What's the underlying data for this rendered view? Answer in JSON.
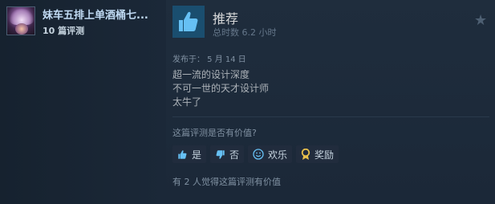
{
  "author": {
    "name": "妹车五排上单酒桶七...",
    "review_count": "10 篇评测"
  },
  "review": {
    "verdict": "推荐",
    "hours": "总时数 6.2 小时",
    "posted": "发布于：  5 月 14 日",
    "lines": [
      "超一流的设计深度",
      "不可一世的天才设计师",
      "太牛了"
    ]
  },
  "helpful": {
    "question": "这篇评测是否有价值?",
    "buttons": [
      {
        "label": "是",
        "icon": "thumbs-up-icon"
      },
      {
        "label": "否",
        "icon": "thumbs-down-icon"
      },
      {
        "label": "欢乐",
        "icon": "smiley-icon"
      },
      {
        "label": "奖励",
        "icon": "award-icon"
      }
    ],
    "found_helpful": "有 2 人觉得这篇评测有价值"
  },
  "colors": {
    "background": "#1b2838",
    "link": "#66c0f4",
    "verdict_box": "#1a4e6f",
    "award": "#e8c04c"
  }
}
